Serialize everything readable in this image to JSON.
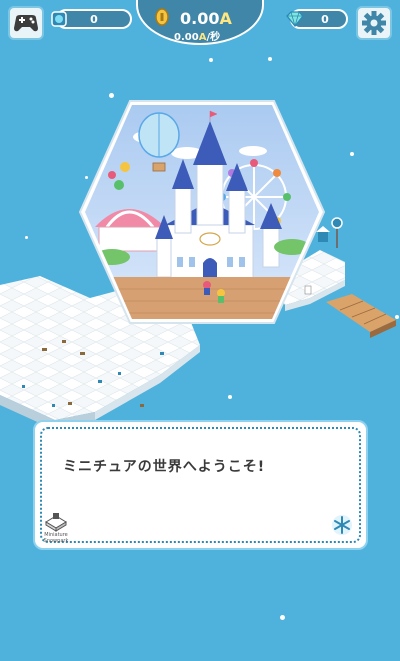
{
  "hud": {
    "gems_count": "0",
    "coins_value": "0.00",
    "coins_unit": "A",
    "coins_rate_value": "0.00",
    "coins_rate_unit": "A",
    "coins_rate_suffix": "/秒",
    "diamonds_count": "0"
  },
  "dialog": {
    "message": "ミニチュアの世界へようこそ!",
    "logo_text": "Miniature Snowpark"
  },
  "icons": {
    "gamepad": "gamepad-icon",
    "gem": "blue-gem-icon",
    "coin": "gold-coin-icon",
    "diamond": "diamond-icon",
    "settings": "gear-icon",
    "snowflake": "snowflake-icon"
  },
  "colors": {
    "background": "#4fb2dc",
    "hud_panel": "#3f86a8",
    "currency_highlight": "#ffe680",
    "dialog_border": "#2e8ab5"
  }
}
